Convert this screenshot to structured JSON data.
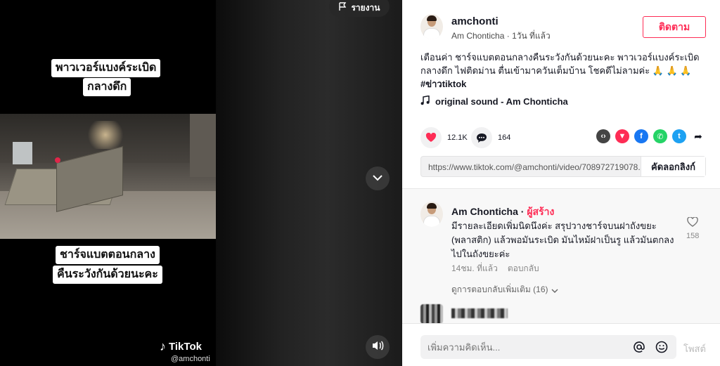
{
  "video": {
    "report_label": "รายงาน",
    "caption_top": [
      "พาวเวอร์แบงค์ระเบิด",
      "กลางดึก"
    ],
    "caption_bottom": [
      "ชาร์จแบตตอนกลาง",
      "คืนระวังกันด้วยนะคะ"
    ],
    "watermark_brand": "TikTok",
    "watermark_handle": "@amchonti",
    "icons": {
      "report": "flag-icon",
      "scroll": "chevron-down-icon",
      "volume": "speaker-icon"
    }
  },
  "post": {
    "username": "amchonti",
    "display_name": "Am Chonticha",
    "time_ago": "1วัน ที่แล้ว",
    "follow_label": "ติดตาม",
    "caption_text": "เตือนค่า ชาร์จแบตตอนกลางคืนระวังกันด้วยนะคะ พาวเวอร์แบงค์ระเบิด กลางดึก ไฟติดม่าน ตื่นเข้ามาควันเต็มบ้าน โชคดีไม่ลามค่ะ 🙏 🙏 🙏",
    "hashtag": "#ข่าวtiktok",
    "sound": "original sound - Am Chonticha",
    "likes": "12.1K",
    "comments": "164",
    "link": "https://www.tiktok.com/@amchonti/video/708972719078...",
    "copy_label": "คัดลอกลิงก์",
    "share_icons": [
      "embed-icon",
      "send-icon",
      "facebook-icon",
      "whatsapp-icon",
      "twitter-icon",
      "share-arrow-icon"
    ]
  },
  "comment": {
    "author": "Am Chonticha",
    "creator_label": "ผู้สร้าง",
    "text": "มีรายละเอียดเพิ่มนิดนึงค่ะ สรุปวางชาร์จบนฝาถังขยะ (พลาสติก) แล้วพอมันระเบิด มันไหม้ฝาเป็นรู แล้วมันตกลงไปในถังขยะค่ะ",
    "time": "14ชม. ที่แล้ว",
    "reply_label": "ตอบกลับ",
    "likes": "158",
    "more_replies": "ดูการตอบกลับเพิ่มเติม (16)"
  },
  "composer": {
    "placeholder": "เพิ่มความคิดเห็น...",
    "post_label": "โพสต์"
  },
  "colors": {
    "accent": "#fe2c55",
    "facebook": "#1877f2",
    "whatsapp": "#25d366",
    "twitter": "#1da1f2",
    "embed": "#444",
    "send": "#fe2c55"
  }
}
